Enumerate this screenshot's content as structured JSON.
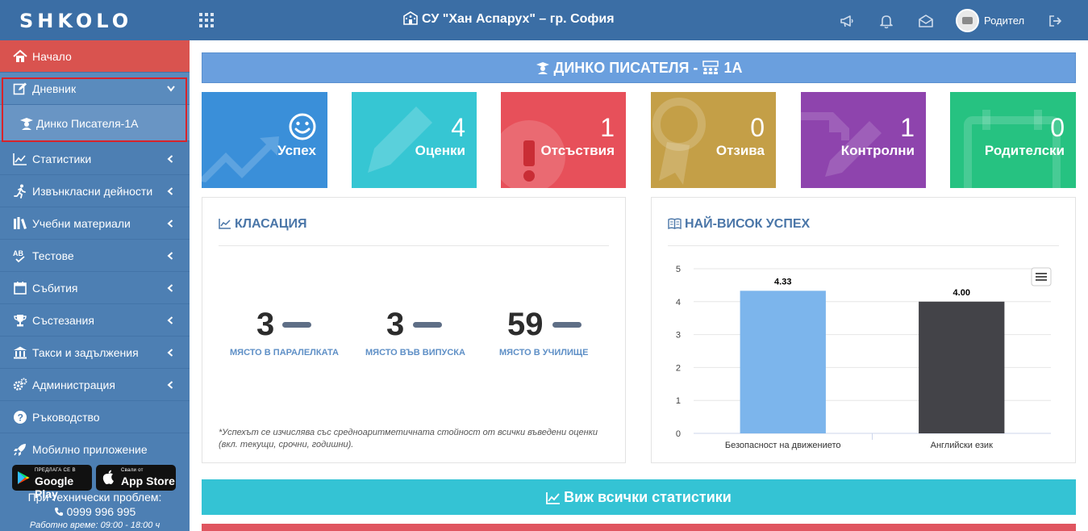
{
  "app": {
    "logo": "SHKOLO",
    "school": "СУ \"Хан Аспарух\" – гр. София"
  },
  "user": {
    "role": "Родител"
  },
  "sidebar": {
    "home": "Начало",
    "diary": "Дневник",
    "diary_sub": "Динко Писателя-1А",
    "items": [
      {
        "label": "Статистики",
        "icon": "chart-line-icon"
      },
      {
        "label": "Извънкласни дейности",
        "icon": "running-icon"
      },
      {
        "label": "Учебни материали",
        "icon": "books-icon"
      },
      {
        "label": "Тестове",
        "icon": "spellcheck-icon"
      },
      {
        "label": "Събития",
        "icon": "calendar-icon"
      },
      {
        "label": "Състезания",
        "icon": "trophy-icon"
      },
      {
        "label": "Такси и задължения",
        "icon": "bank-icon"
      },
      {
        "label": "Администрация",
        "icon": "cogs-icon"
      },
      {
        "label": "Ръководство",
        "icon": "question-circle-icon"
      },
      {
        "label": "Мобилно приложение",
        "icon": "rocket-icon"
      }
    ],
    "google_play_small": "ПРЕДЛАГА СЕ В",
    "google_play": "Google Play",
    "app_store_small": "Свали от",
    "app_store": "App Store",
    "support_title": "При технически проблем:",
    "support_phone": "0999 996 995",
    "support_hours": "Работно време: 09:00 - 18:00 ч"
  },
  "student": {
    "name": "ДИНКО ПИСАТЕЛЯ",
    "separator": "-",
    "class": "1А"
  },
  "cards": [
    {
      "value": "",
      "label": "Успех",
      "color": "#3a8fd9"
    },
    {
      "value": "4",
      "label": "Оценки",
      "color": "#36c6d3"
    },
    {
      "value": "1",
      "label": "Отсъствия",
      "color": "#e7505a"
    },
    {
      "value": "0",
      "label": "Отзива",
      "color": "#c49f47"
    },
    {
      "value": "1",
      "label": "Контролни",
      "color": "#8e44ad"
    },
    {
      "value": "0",
      "label": "Родителски",
      "color": "#26c281"
    }
  ],
  "ranking": {
    "title": "КЛАСАЦИЯ",
    "items": [
      {
        "value": "3",
        "caption": "МЯСТО В ПАРАЛЕЛКАТА"
      },
      {
        "value": "3",
        "caption": "МЯСТО ВЪВ ВИПУСКА"
      },
      {
        "value": "59",
        "caption": "МЯСТО В УЧИЛИЩЕ"
      }
    ],
    "note": "*Успехът се изчислява със средноаритметичната стойност от всички въведени оценки (вкл. текущи, срочни, годишни)."
  },
  "top_success": {
    "title": "НАЙ-ВИСОК УСПЕХ"
  },
  "chart_data": {
    "type": "bar",
    "categories": [
      "Безопасност на движението",
      "Английски език"
    ],
    "values": [
      4.33,
      4.0
    ],
    "data_labels": [
      "4.33",
      "4.00"
    ],
    "colors": [
      "#7cb5ec",
      "#434348"
    ],
    "ylim": [
      0,
      5
    ],
    "yticks": [
      0,
      1,
      2,
      3,
      4,
      5
    ],
    "grid": true,
    "legend": "none"
  },
  "stats_button": "Виж всички статистики"
}
